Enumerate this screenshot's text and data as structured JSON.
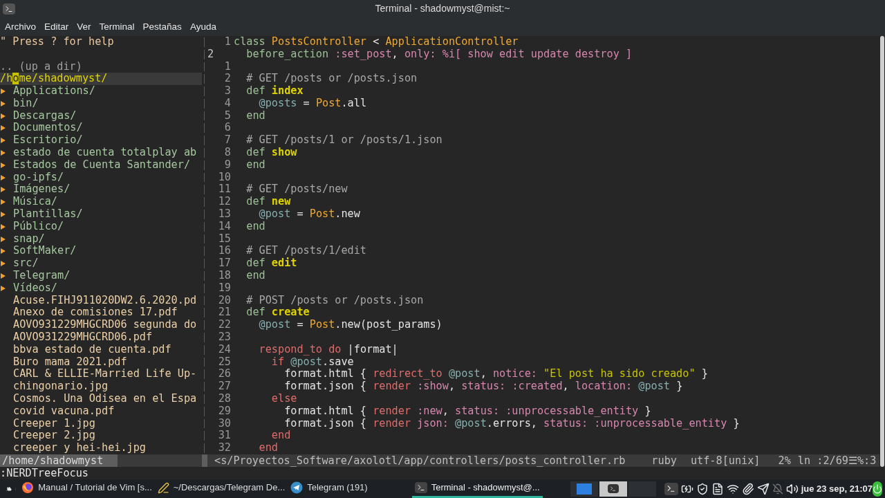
{
  "window": {
    "title": "Terminal - shadowmyst@mist:~"
  },
  "menu": [
    "Archivo",
    "Editar",
    "Ver",
    "Terminal",
    "Pestañas",
    "Ayuda"
  ],
  "tree": {
    "help": "\" Press ? for help",
    "up": ".. (up a dir)",
    "root": {
      "before": "/h",
      "cursor": "o",
      "after": "me/shadowmyst/"
    },
    "items": [
      {
        "kind": "dir",
        "name": "Applications/"
      },
      {
        "kind": "dir",
        "name": "bin/"
      },
      {
        "kind": "dir",
        "name": "Descargas/"
      },
      {
        "kind": "dir",
        "name": "Documentos/"
      },
      {
        "kind": "dir",
        "name": "Escritorio/"
      },
      {
        "kind": "dir",
        "name": "estado de cuenta totalplay ab"
      },
      {
        "kind": "dir",
        "name": "Estados de Cuenta Santander/"
      },
      {
        "kind": "dir",
        "name": "go-ipfs/"
      },
      {
        "kind": "dir",
        "name": "Imágenes/"
      },
      {
        "kind": "dir",
        "name": "Música/"
      },
      {
        "kind": "dir",
        "name": "Plantillas/"
      },
      {
        "kind": "dir",
        "name": "Público/"
      },
      {
        "kind": "dir",
        "name": "snap/"
      },
      {
        "kind": "dir",
        "name": "SoftMaker/"
      },
      {
        "kind": "dir",
        "name": "src/"
      },
      {
        "kind": "dir",
        "name": "Telegram/"
      },
      {
        "kind": "dir",
        "name": "Vídeos/"
      },
      {
        "kind": "file",
        "name": "Acuse.FIHJ911020DW2.6.2020.pd"
      },
      {
        "kind": "file",
        "name": "Anexo de comisiones 17.pdf"
      },
      {
        "kind": "file",
        "name": "AOVO931229MHGCRD06 segunda do"
      },
      {
        "kind": "file",
        "name": "AOVO931229MHGCRD06.pdf"
      },
      {
        "kind": "file",
        "name": "bbva estado de cuenta.pdf"
      },
      {
        "kind": "file",
        "name": "Buro mama 2021.pdf"
      },
      {
        "kind": "file",
        "name": "CARL & ELLIE-Married Life Up-"
      },
      {
        "kind": "file",
        "name": "chingonario.jpg"
      },
      {
        "kind": "file",
        "name": "Cosmos. Una Odisea en el Espa"
      },
      {
        "kind": "file",
        "name": "covid vacuna.pdf"
      },
      {
        "kind": "file",
        "name": "Creeper 1.jpg"
      },
      {
        "kind": "file",
        "name": "Creeper 2.jpg"
      },
      {
        "kind": "file",
        "name": "creeper y hei-hei.jpg"
      }
    ]
  },
  "editor": {
    "lines": [
      {
        "number": "1",
        "current": false,
        "tokens": [
          {
            "kind": "kw",
            "text": "class"
          },
          {
            "kind": "const",
            "text": " PostsController"
          },
          {
            "kind": "plain",
            "text": " < "
          },
          {
            "kind": "const",
            "text": "ApplicationController"
          }
        ]
      },
      {
        "number": "2",
        "current": true,
        "tokens": [
          {
            "kind": "kw",
            "text": "  before_action"
          },
          {
            "kind": "sym",
            "text": " :set_post"
          },
          {
            "kind": "plain",
            "text": ", "
          },
          {
            "kind": "sym",
            "text": "only:"
          },
          {
            "kind": "sym",
            "text": " %i[ show edit update destroy ]"
          }
        ]
      },
      {
        "number": "1",
        "current": false
      },
      {
        "number": "2",
        "current": false,
        "tokens": [
          {
            "kind": "cmt",
            "text": "  # GET /posts or /posts.json"
          }
        ]
      },
      {
        "number": "3",
        "current": false,
        "tokens": [
          {
            "kind": "kw",
            "text": "  def"
          },
          {
            "kind": "name",
            "text": " index"
          }
        ]
      },
      {
        "number": "4",
        "current": false,
        "tokens": [
          {
            "kind": "ivar",
            "text": "    @posts"
          },
          {
            "kind": "plain",
            "text": " = "
          },
          {
            "kind": "const",
            "text": "Post"
          },
          {
            "kind": "plain",
            "text": ".all"
          }
        ]
      },
      {
        "number": "5",
        "current": false,
        "tokens": [
          {
            "kind": "kw",
            "text": "  end"
          }
        ]
      },
      {
        "number": "6",
        "current": false
      },
      {
        "number": "7",
        "current": false,
        "tokens": [
          {
            "kind": "cmt",
            "text": "  # GET /posts/1 or /posts/1.json"
          }
        ]
      },
      {
        "number": "8",
        "current": false,
        "tokens": [
          {
            "kind": "kw",
            "text": "  def"
          },
          {
            "kind": "name",
            "text": " show"
          }
        ]
      },
      {
        "number": "9",
        "current": false,
        "tokens": [
          {
            "kind": "kw",
            "text": "  end"
          }
        ]
      },
      {
        "number": "10",
        "current": false
      },
      {
        "number": "11",
        "current": false,
        "tokens": [
          {
            "kind": "cmt",
            "text": "  # GET /posts/new"
          }
        ]
      },
      {
        "number": "12",
        "current": false,
        "tokens": [
          {
            "kind": "kw",
            "text": "  def"
          },
          {
            "kind": "name",
            "text": " new"
          }
        ]
      },
      {
        "number": "13",
        "current": false,
        "tokens": [
          {
            "kind": "ivar",
            "text": "    @post"
          },
          {
            "kind": "plain",
            "text": " = "
          },
          {
            "kind": "const",
            "text": "Post"
          },
          {
            "kind": "plain",
            "text": ".new"
          }
        ]
      },
      {
        "number": "14",
        "current": false,
        "tokens": [
          {
            "kind": "kw",
            "text": "  end"
          }
        ]
      },
      {
        "number": "15",
        "current": false
      },
      {
        "number": "16",
        "current": false,
        "tokens": [
          {
            "kind": "cmt",
            "text": "  # GET /posts/1/edit"
          }
        ]
      },
      {
        "number": "17",
        "current": false,
        "tokens": [
          {
            "kind": "kw",
            "text": "  def"
          },
          {
            "kind": "name",
            "text": " edit"
          }
        ]
      },
      {
        "number": "18",
        "current": false,
        "tokens": [
          {
            "kind": "kw",
            "text": "  end"
          }
        ]
      },
      {
        "number": "19",
        "current": false
      },
      {
        "number": "20",
        "current": false,
        "tokens": [
          {
            "kind": "cmt",
            "text": "  # POST /posts or /posts.json"
          }
        ]
      },
      {
        "number": "21",
        "current": false,
        "tokens": [
          {
            "kind": "kw",
            "text": "  def"
          },
          {
            "kind": "name",
            "text": " create"
          }
        ]
      },
      {
        "number": "22",
        "current": false,
        "tokens": [
          {
            "kind": "ivar",
            "text": "    @post"
          },
          {
            "kind": "plain",
            "text": " = "
          },
          {
            "kind": "const",
            "text": "Post"
          },
          {
            "kind": "plain",
            "text": ".new(post_params)"
          }
        ]
      },
      {
        "number": "23",
        "current": false
      },
      {
        "number": "24",
        "current": false,
        "tokens": [
          {
            "kind": "red",
            "text": "    respond_to do"
          },
          {
            "kind": "plain",
            "text": " |format|"
          }
        ]
      },
      {
        "number": "25",
        "current": false,
        "tokens": [
          {
            "kind": "red",
            "text": "      if"
          },
          {
            "kind": "ivar",
            "text": " @post"
          },
          {
            "kind": "plain",
            "text": ".save"
          }
        ]
      },
      {
        "number": "26",
        "current": false,
        "tokens": [
          {
            "kind": "plain",
            "text": "        format.html { "
          },
          {
            "kind": "red",
            "text": "redirect_to"
          },
          {
            "kind": "ivar",
            "text": " @post"
          },
          {
            "kind": "plain",
            "text": ", "
          },
          {
            "kind": "sym",
            "text": "notice:"
          },
          {
            "kind": "str",
            "text": " \"El post ha sido creado\""
          },
          {
            "kind": "plain",
            "text": " }"
          }
        ]
      },
      {
        "number": "27",
        "current": false,
        "tokens": [
          {
            "kind": "plain",
            "text": "        format.json { "
          },
          {
            "kind": "red",
            "text": "render"
          },
          {
            "kind": "sym",
            "text": " :show"
          },
          {
            "kind": "plain",
            "text": ", "
          },
          {
            "kind": "sym",
            "text": "status:"
          },
          {
            "kind": "sym",
            "text": " :created"
          },
          {
            "kind": "plain",
            "text": ", "
          },
          {
            "kind": "sym",
            "text": "location:"
          },
          {
            "kind": "ivar",
            "text": " @post"
          },
          {
            "kind": "plain",
            "text": " }"
          }
        ]
      },
      {
        "number": "28",
        "current": false,
        "tokens": [
          {
            "kind": "red",
            "text": "      else"
          }
        ]
      },
      {
        "number": "29",
        "current": false,
        "tokens": [
          {
            "kind": "plain",
            "text": "        format.html { "
          },
          {
            "kind": "red",
            "text": "render"
          },
          {
            "kind": "sym",
            "text": " :new"
          },
          {
            "kind": "plain",
            "text": ", "
          },
          {
            "kind": "sym",
            "text": "status:"
          },
          {
            "kind": "sym",
            "text": " :unprocessable_entity"
          },
          {
            "kind": "plain",
            "text": " }"
          }
        ]
      },
      {
        "number": "30",
        "current": false,
        "tokens": [
          {
            "kind": "plain",
            "text": "        format.json { "
          },
          {
            "kind": "red",
            "text": "render"
          },
          {
            "kind": "sym",
            "text": " json:"
          },
          {
            "kind": "ivar",
            "text": " @post"
          },
          {
            "kind": "plain",
            "text": ".errors, "
          },
          {
            "kind": "sym",
            "text": "status:"
          },
          {
            "kind": "sym",
            "text": " :unprocessable_entity"
          },
          {
            "kind": "plain",
            "text": " }"
          }
        ]
      },
      {
        "number": "31",
        "current": false,
        "tokens": [
          {
            "kind": "red",
            "text": "      end"
          }
        ]
      },
      {
        "number": "32",
        "current": false,
        "tokens": [
          {
            "kind": "red",
            "text": "    end"
          }
        ]
      }
    ]
  },
  "status_line": {
    "tree_path": "/home/shadowmyst",
    "file": "<s/Proyectos_Software/axolotl/app/controllers/posts_controller.rb",
    "filetype": "ruby",
    "encoding": "utf-8[unix]",
    "percent": "2%",
    "position": "ln :2/69☰%:3"
  },
  "command_line": ":NERDTreeFocus",
  "taskbar": {
    "tasks": [
      {
        "kind": "firefox",
        "label": "Manual / Tutorial de Vim [s...",
        "selected": false
      },
      {
        "kind": "editor",
        "label": "~/Descargas/Telegram De...",
        "selected": false
      },
      {
        "kind": "telegram",
        "label": "Telegram (191)",
        "selected": false
      },
      {
        "kind": "terminal",
        "label": "Terminal - shadowmyst@...",
        "selected": true
      }
    ],
    "workspaces": [
      {
        "kind": "window",
        "selected": false
      },
      {
        "kind": "terminal",
        "selected": true
      },
      {
        "kind": "empty",
        "selected": false
      }
    ],
    "clock": "jue 23 sep, 21:07"
  }
}
